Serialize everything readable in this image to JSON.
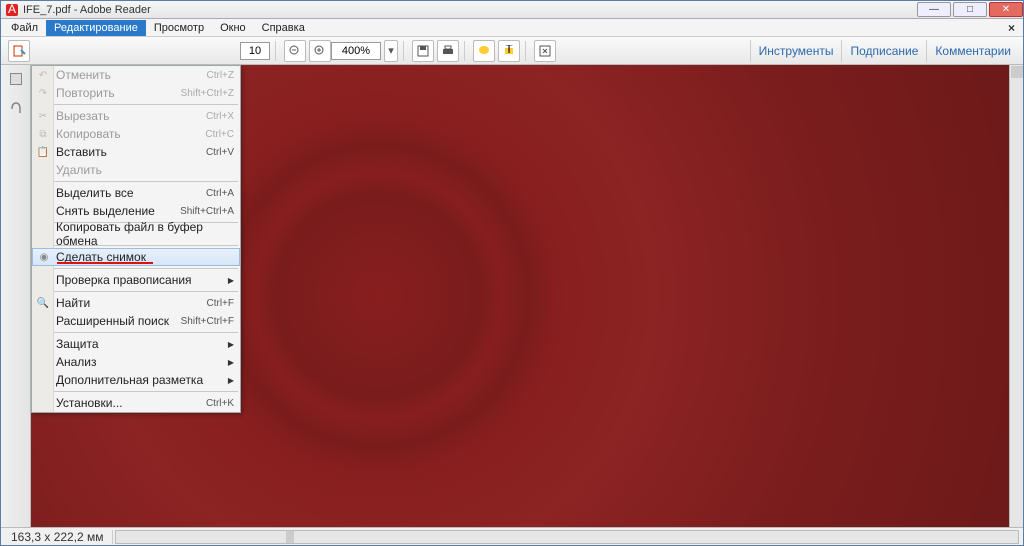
{
  "window": {
    "title": "IFE_7.pdf - Adobe Reader"
  },
  "menubar": {
    "items": [
      "Файл",
      "Редактирование",
      "Просмотр",
      "Окно",
      "Справка"
    ],
    "selected_index": 1
  },
  "toolbar": {
    "page_field": "10",
    "zoom_value": "400%",
    "right_tabs": [
      "Инструменты",
      "Подписание",
      "Комментарии"
    ]
  },
  "dropdown": {
    "items": [
      {
        "label": "Отменить",
        "shortcut": "Ctrl+Z",
        "disabled": true,
        "icon": "undo-icon"
      },
      {
        "label": "Повторить",
        "shortcut": "Shift+Ctrl+Z",
        "disabled": true,
        "icon": "redo-icon"
      },
      {
        "sep": true
      },
      {
        "label": "Вырезать",
        "shortcut": "Ctrl+X",
        "disabled": true,
        "icon": "cut-icon"
      },
      {
        "label": "Копировать",
        "shortcut": "Ctrl+C",
        "disabled": true,
        "icon": "copy-icon"
      },
      {
        "label": "Вставить",
        "shortcut": "Ctrl+V",
        "icon": "paste-icon"
      },
      {
        "label": "Удалить",
        "disabled": true
      },
      {
        "sep": true
      },
      {
        "label": "Выделить все",
        "shortcut": "Ctrl+A"
      },
      {
        "label": "Снять выделение",
        "shortcut": "Shift+Ctrl+A"
      },
      {
        "sep": true
      },
      {
        "label": "Копировать файл в буфер обмена"
      },
      {
        "sep": true
      },
      {
        "label": "Сделать снимок",
        "highlight": true,
        "icon": "snapshot-icon",
        "underline": true
      },
      {
        "sep": true
      },
      {
        "label": "Проверка правописания",
        "submenu": true
      },
      {
        "sep": true
      },
      {
        "label": "Найти",
        "shortcut": "Ctrl+F",
        "icon": "find-icon"
      },
      {
        "label": "Расширенный поиск",
        "shortcut": "Shift+Ctrl+F"
      },
      {
        "sep": true
      },
      {
        "label": "Защита",
        "submenu": true
      },
      {
        "label": "Анализ",
        "submenu": true
      },
      {
        "label": "Дополнительная разметка",
        "submenu": true
      },
      {
        "sep": true
      },
      {
        "label": "Установки...",
        "shortcut": "Ctrl+K"
      }
    ]
  },
  "status": {
    "dimensions": "163,3 x 222,2 мм"
  }
}
